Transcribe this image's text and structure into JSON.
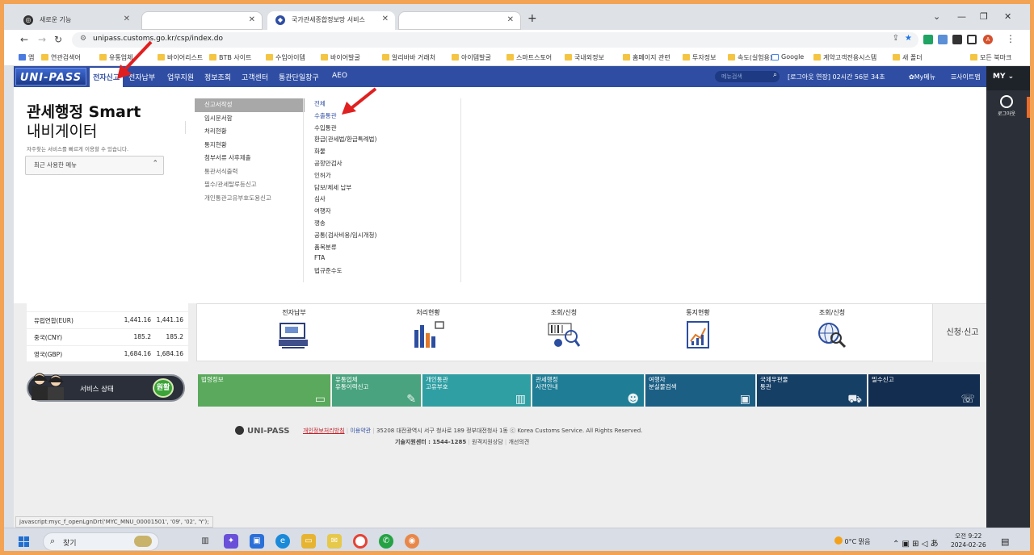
{
  "browser": {
    "tabs": [
      {
        "title": "새로운 기능",
        "active": false
      },
      {
        "title": "",
        "active": false
      },
      {
        "title": "국가관세종합정보망 서비스",
        "active": true
      },
      {
        "title": "",
        "active": false
      }
    ],
    "url": "unipass.customs.go.kr/csp/index.do",
    "bookmarks": [
      "앱",
      "연관검색어",
      "유통업체",
      "바이어리스트",
      "BTB 사이트",
      "수입아이템",
      "바이어발굴",
      "알리바바 거래처",
      "아이템발굴",
      "스마트스토어",
      "국내외정보",
      "홈페이지 관련",
      "투자정보",
      "속도(실험용)",
      "Google",
      "계약고객전용시스템",
      "새 폴더",
      "모든 북마크"
    ],
    "status_link": "javascript:myc_f_openLgnDrt('MYC_MNU_00001501', '09', '02', 'Y');"
  },
  "site": {
    "logo": "UNI-PASS",
    "gnb": [
      "전자신고",
      "전자납부",
      "업무지원",
      "정보조회",
      "고객센터",
      "통관단일창구",
      "AEO"
    ],
    "search_placeholder": "메뉴검색",
    "logout_timer": "[로그아웃 연장] 02시간 56분 34초",
    "my_menu": "My메뉴",
    "sitemap": "사이트맵",
    "mega": {
      "title_line1": "관세행정 Smart",
      "title_line2": "내비게이터",
      "subtitle": "자주찾는 서비스를 빠르게 이용할 수 있습니다.",
      "recent": "최근 사용한 메뉴",
      "level1": [
        "신고서작성",
        "임시문서함",
        "처리현황",
        "통지현황",
        "첨부서류 사후제출",
        "통관서식출력",
        "필수/관세탈루등신고",
        "개인통관고유부호도용신고"
      ],
      "level2": [
        "전체",
        "수출통관",
        "수입통관",
        "환급(관세법/환급특례법)",
        "화물",
        "공항만검사",
        "인허가",
        "담보/체세 납부",
        "심사",
        "여행자",
        "쟁송",
        "공통(검사비용/임시개청)",
        "품목분류",
        "FTA",
        "법규준수도"
      ]
    },
    "exchange": [
      {
        "country": "유럽연합(EUR)",
        "v1": "1,441.16",
        "v2": "1,441.16"
      },
      {
        "country": "중국(CNY)",
        "v1": "185.2",
        "v2": "185.2"
      },
      {
        "country": "영국(GBP)",
        "v1": "1,684.16",
        "v2": "1,684.16"
      }
    ],
    "quick": [
      {
        "label": "전자납부"
      },
      {
        "label": "처리현황"
      },
      {
        "label": "조회/신청"
      },
      {
        "label": "통지현황"
      },
      {
        "label": "조회/신청"
      }
    ],
    "apply": "신청·신고",
    "service_status": "서비스 상태",
    "service_ok": "원활",
    "services": [
      {
        "l1": "법령정보",
        "l2": "",
        "color": "#5aa95c"
      },
      {
        "l1": "유통업체",
        "l2": "유통이력신고",
        "color": "#4aa37f"
      },
      {
        "l1": "개인통관",
        "l2": "고유부호",
        "color": "#2f9fa3"
      },
      {
        "l1": "관세행정",
        "l2": "사전안내",
        "color": "#1f7d95"
      },
      {
        "l1": "여행자",
        "l2": "분실물검색",
        "color": "#1c5f85"
      },
      {
        "l1": "국제우편물",
        "l2": "통관",
        "color": "#163f66"
      },
      {
        "l1": "밀수신고",
        "l2": "",
        "color": "#122d4f"
      }
    ],
    "footer": {
      "logo": "UNI-PASS",
      "privacy": "개인정보처리방침",
      "terms": "이용약관",
      "address": "35208 대전광역시 서구 청사로 189 정부대전청사 1동 ⓒ Korea Customs Service. All Rights Reserved.",
      "support_label": "기술지원센터 : 1544-1285",
      "remote": "원격지원상담",
      "improve": "개선의견"
    },
    "sidebar": {
      "my": "MY",
      "logout": "로그아웃"
    }
  },
  "taskbar": {
    "search": "찾기",
    "weather": "0°C 맑음",
    "time": "오전 9:22",
    "date": "2024-02-26"
  },
  "colors": {
    "gnb": "#2f4ea3",
    "frame": "#f2a354",
    "arrow": "#e02020"
  }
}
